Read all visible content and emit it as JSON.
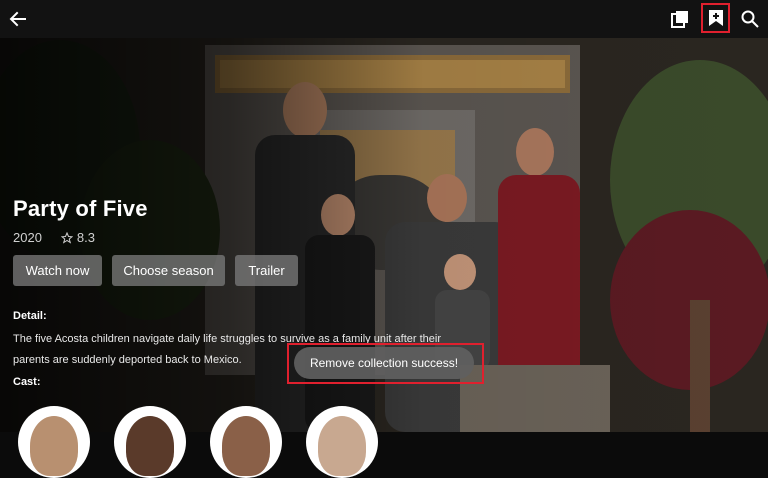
{
  "header": {
    "back_icon": "arrow-left-icon",
    "library_icon": "library-icon",
    "collect_icon": "bookmark-plus-icon",
    "search_icon": "search-icon"
  },
  "show": {
    "title": "Party of Five",
    "year": "2020",
    "rating": "8.3",
    "star_icon": "star-outline-icon"
  },
  "actions": {
    "watch_now": "Watch now",
    "choose_season": "Choose season",
    "trailer": "Trailer"
  },
  "detail": {
    "label": "Detail:",
    "text": "The five Acosta children navigate daily life struggles to survive as a family unit after their parents are suddenly deported back to Mexico."
  },
  "cast": {
    "label": "Cast:"
  },
  "toast": {
    "message": "Remove collection success!"
  },
  "colors": {
    "highlight": "#e0202e",
    "topbar": "#121212",
    "button_bg": "#787878"
  }
}
